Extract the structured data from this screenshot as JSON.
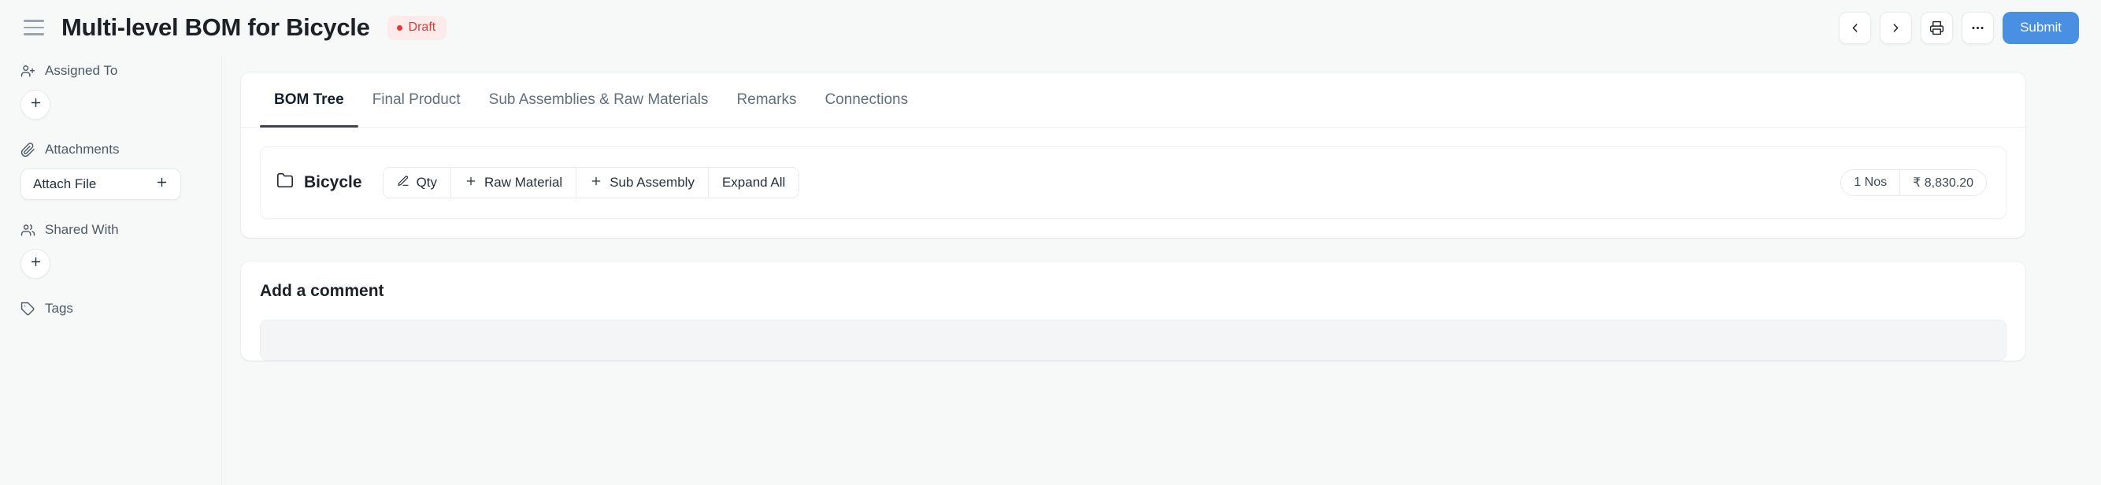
{
  "header": {
    "menu_icon": "hamburger-icon",
    "title": "Multi-level BOM for Bicycle",
    "status": "Draft",
    "status_color": "#e03b3b",
    "status_bg": "#fdeaea",
    "actions": {
      "prev_icon": "chevron-left-icon",
      "next_icon": "chevron-right-icon",
      "print_icon": "printer-icon",
      "more_icon": "ellipsis-icon",
      "submit_label": "Submit",
      "submit_color": "#4a90e2"
    }
  },
  "sidebar": {
    "groups": [
      {
        "label": "Assigned To",
        "icon": "user-plus-icon",
        "control": "add-circle"
      },
      {
        "label": "Attachments",
        "icon": "paperclip-icon",
        "control": "attach-button",
        "button_label": "Attach File",
        "button_icon": "plus-icon"
      },
      {
        "label": "Shared With",
        "icon": "users-icon",
        "control": "add-circle"
      },
      {
        "label": "Tags",
        "icon": "tag-icon",
        "control": "none"
      }
    ]
  },
  "main": {
    "tabs": [
      {
        "label": "BOM Tree",
        "active": true
      },
      {
        "label": "Final Product",
        "active": false
      },
      {
        "label": "Sub Assemblies & Raw Materials",
        "active": false
      },
      {
        "label": "Remarks",
        "active": false
      },
      {
        "label": "Connections",
        "active": false
      }
    ],
    "tree": {
      "node_icon": "folder-icon",
      "node_label": "Bicycle",
      "actions": [
        {
          "label": "Qty",
          "icon": "pencil-icon"
        },
        {
          "label": "Raw Material",
          "icon": "plus-icon"
        },
        {
          "label": "Sub Assembly",
          "icon": "plus-icon"
        },
        {
          "label": "Expand All",
          "icon": "none"
        }
      ],
      "quantity": "1 Nos",
      "amount": "₹ 8,830.20"
    },
    "comment": {
      "title": "Add a comment",
      "placeholder": ""
    }
  }
}
